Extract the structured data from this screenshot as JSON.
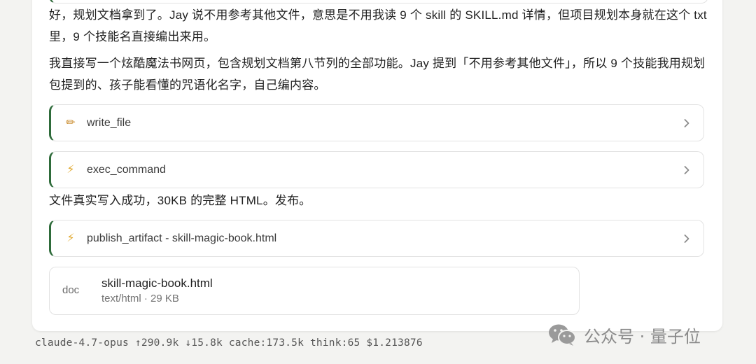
{
  "messages": {
    "para1": "好，规划文档拿到了。Jay 说不用参考其他文件，意思是不用我读 9 个 skill 的 SKILL.md 详情，但项目规划本身就在这个 txt 里，9 个技能名直接编出来用。",
    "para2": "我直接写一个炫酷魔法书网页，包含规划文档第八节列的全部功能。Jay 提到「不用参考其他文件」，所以 9 个技能我用规划包提到的、孩子能看懂的咒语化名字，自己编内容。",
    "para3": "文件真实写入成功，30KB 的完整 HTML。发布。"
  },
  "tools": [
    {
      "icon": "pencil-icon",
      "glyph": "✏",
      "label": "write_file"
    },
    {
      "icon": "lightning-icon",
      "glyph": "⚡",
      "label": "exec_command"
    },
    {
      "icon": "lightning-icon",
      "glyph": "⚡",
      "label": "publish_artifact - skill-magic-book.html"
    }
  ],
  "file": {
    "type": "doc",
    "name": "skill-magic-book.html",
    "meta": "text/html · 29 KB"
  },
  "status": {
    "model": "claude-4.7-opus",
    "tokens_up": "↑290.9k",
    "tokens_down": "↓15.8k",
    "cache": "cache:173.5k",
    "think": "think:65",
    "cost": "$1.213876"
  },
  "watermark": {
    "icon": "wechat-icon",
    "text": "公众号 · 量子位"
  },
  "colors": {
    "accent": "#2e6b3a",
    "border": "#e2e2e2",
    "background": "#f3f3f1"
  }
}
